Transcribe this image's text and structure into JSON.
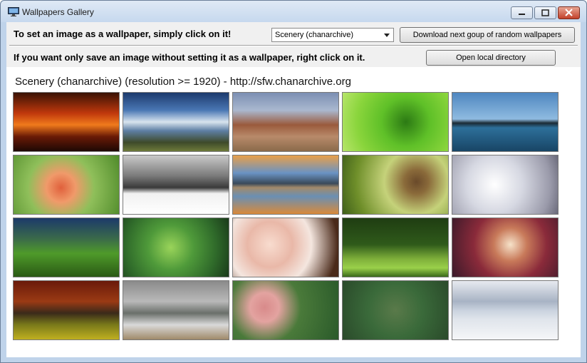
{
  "window": {
    "title": "Wallpapers Gallery"
  },
  "toolbar": {
    "instruction_click": "To set an image as a wallpaper, simply click on it!",
    "instruction_right_click": "If you want only save an image without setting it as a wallpaper, right click on it.",
    "category_selected": "Scenery (chanarchive)",
    "download_button": "Download next goup of random wallpapers",
    "open_dir_button": "Open local directory"
  },
  "gallery": {
    "heading": "Scenery (chanarchive) (resolution >= 1920)  -  http://sfw.chanarchive.org",
    "thumbnails": [
      {
        "subject": "windmill-sunset",
        "bg": "linear-gradient(#3a1205 0%, #c0380c 35%, #f07a1c 55%, #6a1a06 75%, #1d0804 100%)"
      },
      {
        "subject": "cloudy-sky-field",
        "bg": "linear-gradient(#1c3a6d 0%, #4a77b4 30%, #d8e4ee 50%, #5e7fa4 65%, #3e4a2a 85%, #6d7a3a 100%)"
      },
      {
        "subject": "canyon-valley",
        "bg": "linear-gradient(#7b8fb3 0%, #aab8cf 30%, #9a5a3c 55%, #b88a6a 75%, #8a6a4a 100%)"
      },
      {
        "subject": "green-leaf",
        "bg": "radial-gradient(circle at 60% 50%, #2c7a14 0%, #5fc028 35%, #8ad53c 70%, #b7e56a 100%)"
      },
      {
        "subject": "lake-horizon",
        "bg": "linear-gradient(#4e86c0 0%, #8fbbe0 45%, #1b2a34 52%, #2d6f9a 60%, #184565 100%)"
      },
      {
        "subject": "tulips",
        "bg": "radial-gradient(circle at 45% 55%, #e0603c 0%, #f09a6a 22%, #8fbf5a 50%, #4f8a2a 100%)"
      },
      {
        "subject": "snowy-landscape",
        "bg": "linear-gradient(#c9c9c9 0%, #7a7a7a 35%, #3a3a3a 55%, #f1f1f1 65%, #ffffff 100%)"
      },
      {
        "subject": "mountain-lake-reflection",
        "bg": "linear-gradient(#e9a04a 0%, #6a93c3 30%, #3a4a5a 48%, #a38a6a 55%, #6a8fb3 70%, #d98a3a 100%)"
      },
      {
        "subject": "pine-cones",
        "bg": "radial-gradient(circle at 70% 45%, #6a4a2a 0%, #8a6a3a 15%, #c5d27a 40%, #6f8f2a 75%, #3f5f1a 100%)"
      },
      {
        "subject": "frost-flowers",
        "bg": "radial-gradient(circle at 40% 50%, #ffffff 0%, #d6d8e2 40%, #9a9aaa 80%, #6a6a7a 100%)"
      },
      {
        "subject": "grass-dew",
        "bg": "linear-gradient(#1c3a6a 0%, #3a6a4a 35%, #4f9a2a 60%, #2a5a14 100%)"
      },
      {
        "subject": "succulent",
        "bg": "radial-gradient(circle at 45% 50%, #9ad45a 0%, #4f9a3a 35%, #2f6a2a 70%, #1a3a1a 100%)"
      },
      {
        "subject": "cherry-blossom",
        "bg": "radial-gradient(circle at 35% 45%, #f8dccf 0%, #e9b8a8 30%, #f4e6df 55%, #4a2a1a 90%)"
      },
      {
        "subject": "sprout",
        "bg": "linear-gradient(#1f3d12 0%, #2f5a1a 45%, #7fb03a 70%, #9ad04a 85%, #3a6a1a 100%)"
      },
      {
        "subject": "orchid",
        "bg": "radial-gradient(circle at 55% 45%, #f6e2c9 0%, #c87a5a 25%, #8a2a3a 55%, #3a1a2a 100%)"
      },
      {
        "subject": "autumn-bench",
        "bg": "linear-gradient(#6a1a0a 0%, #9a3a14 35%, #3a2a1a 55%, #7a7a1a 75%, #c0b020 100%)"
      },
      {
        "subject": "seaside-pier",
        "bg": "linear-gradient(#8a8a8a 0%, #b9b9b9 35%, #6a6f6a 55%, #d9d9d9 75%, #a08a6a 100%)"
      },
      {
        "subject": "zinnia-flower",
        "bg": "radial-gradient(circle at 30% 45%, #d88a8a 0%, #e3a3a0 18%, #4a7a3a 45%, #2a5a2a 100%)"
      },
      {
        "subject": "blurred-green",
        "bg": "radial-gradient(circle at 50% 50%, #5a7a4a 0%, #3a6a3a 45%, #2a4a2a 100%)"
      },
      {
        "subject": "salt-flat-reflection",
        "bg": "linear-gradient(#e7eaf0 0%, #a8b3c4 35%, #c9d2de 50%, #dfe4eb 65%, #f5f6f8 100%)"
      }
    ]
  }
}
